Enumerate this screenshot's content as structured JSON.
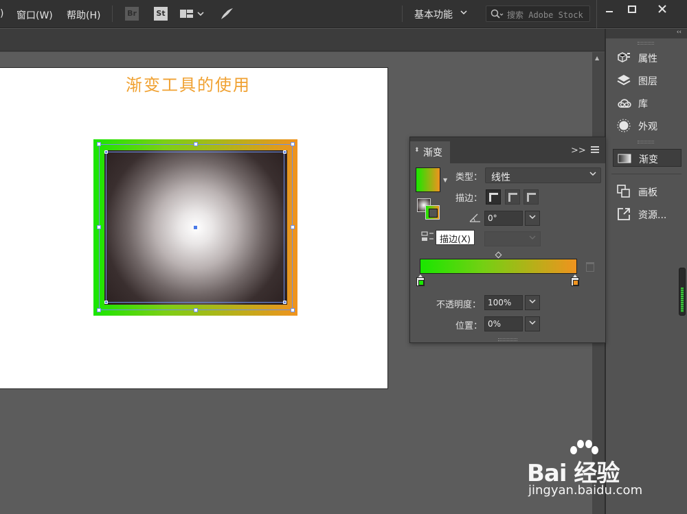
{
  "menubar": {
    "items": [
      ")",
      "窗口(W)",
      "帮助(H)"
    ],
    "bridge_label": "Br",
    "stock_label": "St",
    "workspace": "基本功能",
    "stock_search_placeholder": "搜索 Adobe Stock"
  },
  "artboard": {
    "title": "渐变工具的使用",
    "title_color": "#f0a131"
  },
  "object": {
    "stroke_gradient": [
      "#19e600",
      "#f0931e"
    ],
    "fill_gradient_type": "radial",
    "fill_colors": [
      "#ffffff",
      "#2b2020"
    ]
  },
  "dock": {
    "items": [
      {
        "label": "属性",
        "icon": "properties-icon"
      },
      {
        "label": "图层",
        "icon": "layers-icon"
      },
      {
        "label": "库",
        "icon": "libraries-icon"
      },
      {
        "label": "外观",
        "icon": "appearance-icon"
      },
      {
        "label": "渐变",
        "icon": "gradient-icon"
      },
      {
        "label": "画板",
        "icon": "artboards-icon"
      },
      {
        "label": "资源...",
        "icon": "asset-export-icon"
      }
    ]
  },
  "gradient_panel": {
    "title": "渐变",
    "type_label": "类型：",
    "type_value": "线性",
    "stroke_label": "描边：",
    "angle_value": "0°",
    "tooltip": "描边(X)",
    "opacity_label": "不透明度：",
    "opacity_value": "100%",
    "location_label": "位置：",
    "location_value": "0%",
    "stops": [
      {
        "color": "#19e600",
        "position": 0
      },
      {
        "color": "#f0931e",
        "position": 100
      }
    ]
  },
  "watermark": {
    "brand": "Bai 经验",
    "url": "jingyan.baidu.com"
  }
}
